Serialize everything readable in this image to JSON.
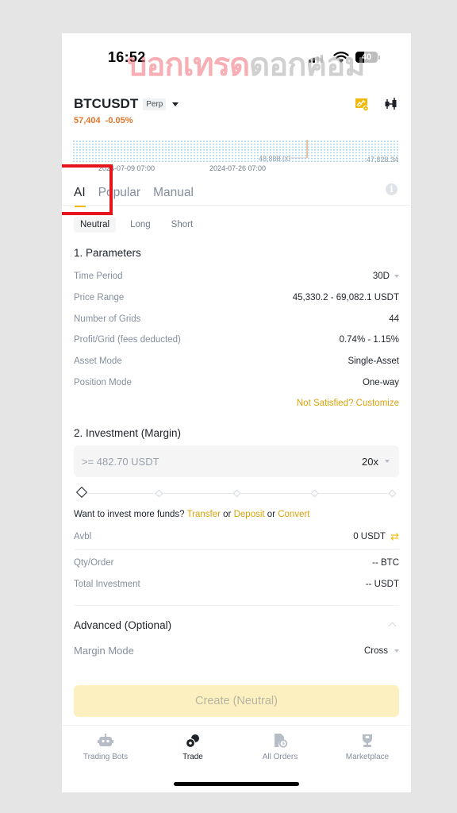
{
  "status_bar": {
    "time": "16:52",
    "battery": "40",
    "watermark_part1": "บอกเทรด",
    "watermark_part2": "ดอกคอม"
  },
  "header": {
    "pair": "BTCUSDT",
    "contract_type": "Perp",
    "price": "57,404",
    "change": "-0.05%",
    "icons": [
      "grid-chart-icon",
      "candlestick-icon"
    ]
  },
  "chart": {
    "marker_label": "48,888.00",
    "right_label": "47,828.34",
    "dates": [
      "2024-07-09 07:00",
      "2024-07-26 07:00"
    ]
  },
  "tabs": [
    {
      "label": "AI",
      "active": true
    },
    {
      "label": "Popular",
      "active": false
    },
    {
      "label": "Manual",
      "active": false
    }
  ],
  "modes": [
    {
      "label": "Neutral",
      "active": true
    },
    {
      "label": "Long",
      "active": false
    },
    {
      "label": "Short",
      "active": false
    }
  ],
  "parameters": {
    "title": "1. Parameters",
    "rows": [
      {
        "label": "Time Period",
        "value": "30D"
      },
      {
        "label": "Price Range",
        "value": "45,330.2 - 69,082.1 USDT"
      },
      {
        "label": "Number of Grids",
        "value": "44"
      },
      {
        "label": "Profit/Grid (fees deducted)",
        "value": "0.74% - 1.15%"
      },
      {
        "label": "Asset Mode",
        "value": "Single-Asset"
      },
      {
        "label": "Position Mode",
        "value": "One-way"
      }
    ],
    "customize_link": "Not Satisfied? Customize"
  },
  "investment": {
    "title": "2. Investment (Margin)",
    "input_value": "",
    "placeholder": ">= 482.70 USDT",
    "leverage": "20x",
    "slider_percent": 0,
    "funds_prompt": "Want to invest more funds?",
    "or": "or",
    "links": [
      "Transfer",
      "Deposit",
      "Convert"
    ],
    "avbl_label": "Avbl",
    "avbl_value": "0 USDT",
    "qty_label": "Qty/Order",
    "qty_value": "-- BTC",
    "total_label": "Total Investment",
    "total_value": "-- USDT"
  },
  "advanced": {
    "title": "Advanced (Optional)",
    "margin_mode_label": "Margin Mode",
    "margin_mode_value": "Cross"
  },
  "create_button": "Create (Neutral)",
  "bottom_nav": [
    {
      "label": "Trading Bots",
      "icon": "robot-icon",
      "active": false
    },
    {
      "label": "Trade",
      "icon": "trade-icon",
      "active": true
    },
    {
      "label": "All Orders",
      "icon": "orders-icon",
      "active": false
    },
    {
      "label": "Marketplace",
      "icon": "trophy-icon",
      "active": false
    }
  ],
  "colors": {
    "accent": "#f0b90b",
    "link": "#d9a20b",
    "price": "#e0762b",
    "highlight_box": "#e8141c"
  }
}
